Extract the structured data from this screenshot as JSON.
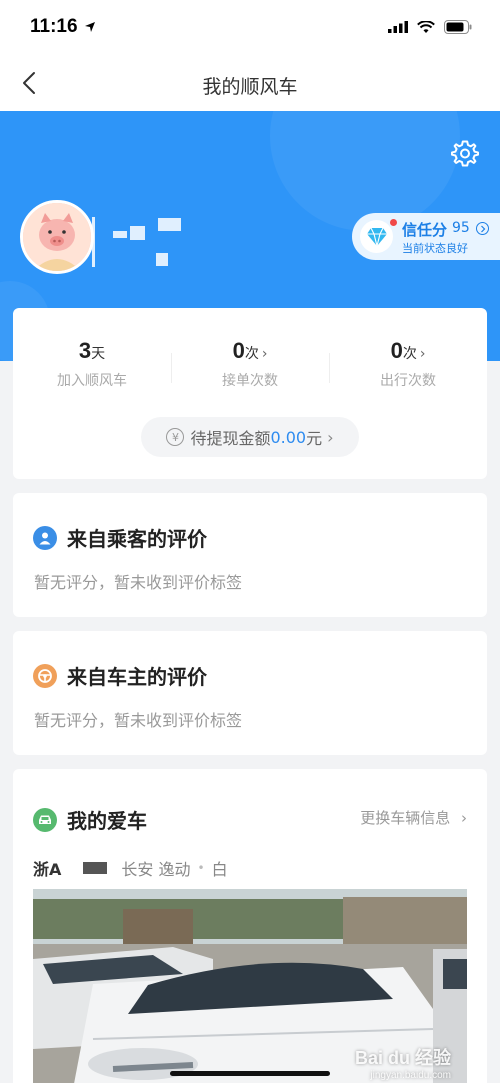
{
  "status_bar": {
    "time": "11:16"
  },
  "nav": {
    "title": "我的顺风车"
  },
  "profile": {
    "credit_label": "信任分",
    "credit_score": "95",
    "credit_status": "当前状态良好"
  },
  "stats": [
    {
      "value": "3",
      "unit": "天",
      "label": "加入顺风车",
      "chevron": ""
    },
    {
      "value": "0",
      "unit": "次",
      "label": "接单次数",
      "chevron": "›"
    },
    {
      "value": "0",
      "unit": "次",
      "label": "出行次数",
      "chevron": "›"
    }
  ],
  "withdraw": {
    "icon": "¥",
    "label": "待提现金额",
    "amount": "0.00",
    "currency": "元",
    "chevron": "›"
  },
  "passenger_reviews": {
    "title": "来自乘客的评价",
    "subtitle": "暂无评分，暂未收到评价标签"
  },
  "driver_reviews": {
    "title": "来自车主的评价",
    "subtitle": "暂无评分，暂未收到评价标签"
  },
  "my_car": {
    "title": "我的爱车",
    "change_link": "更换车辆信息",
    "chevron": "›",
    "plate": "浙A",
    "model": "长安 逸动",
    "separator": "•",
    "color": "白"
  },
  "watermark": {
    "brand": "Bai du 经验",
    "url": "jingyan.baidu.com"
  },
  "colors": {
    "brand_blue": "#2e95f8",
    "link_blue": "#2e8cf0",
    "passenger_icon": "#3a8ee6",
    "driver_icon": "#f0a05a",
    "car_icon": "#56b96e"
  }
}
